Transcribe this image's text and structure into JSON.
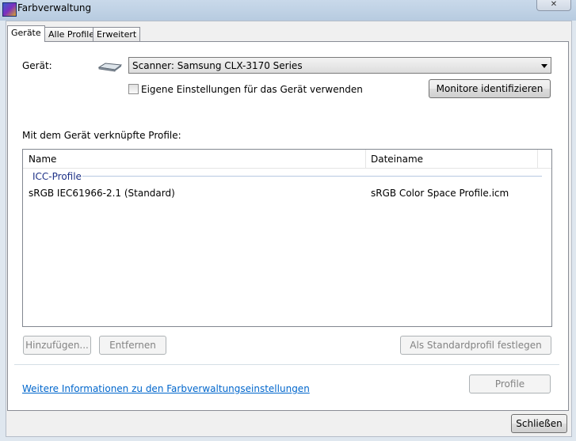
{
  "window": {
    "title": "Farbverwaltung",
    "close_label": "✕"
  },
  "tabs": [
    {
      "label": "Geräte"
    },
    {
      "label": "Alle Profile"
    },
    {
      "label": "Erweitert"
    }
  ],
  "device": {
    "label": "Gerät:",
    "selected": "Scanner: Samsung CLX-3170 Series",
    "icon": "scanner-icon",
    "own_settings_label": "Eigene Einstellungen für das Gerät verwenden",
    "own_settings_checked": false,
    "identify_button": "Monitore identifizieren"
  },
  "profiles": {
    "section_label": "Mit dem Gerät verknüpfte Profile:",
    "columns": [
      "Name",
      "Dateiname"
    ],
    "group": "ICC-Profile",
    "rows": [
      {
        "name": "sRGB IEC61966-2.1 (Standard)",
        "file": "sRGB Color Space Profile.icm"
      }
    ]
  },
  "buttons": {
    "add": "Hinzufügen...",
    "remove": "Entfernen",
    "set_default": "Als Standardprofil festlegen",
    "profiles": "Profile",
    "close": "Schließen"
  },
  "footer": {
    "link": "Weitere Informationen zu den Farbverwaltungseinstellungen"
  }
}
